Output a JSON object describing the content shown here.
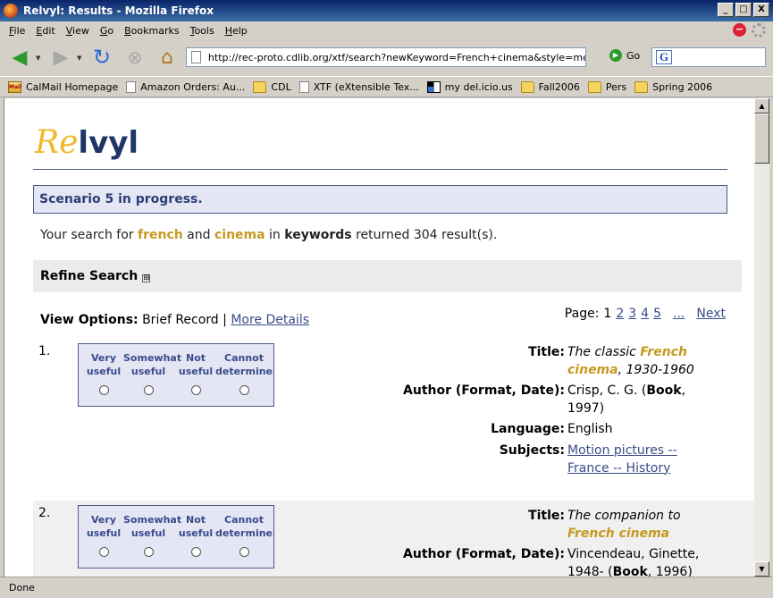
{
  "window": {
    "title": "Relvyl: Results - Mozilla Firefox",
    "buttons": [
      "_",
      "□",
      "X"
    ]
  },
  "menu": [
    {
      "key": "F",
      "rest": "ile"
    },
    {
      "key": "E",
      "rest": "dit"
    },
    {
      "key": "V",
      "rest": "iew"
    },
    {
      "key": "G",
      "rest": "o"
    },
    {
      "key": "B",
      "rest": "ookmarks"
    },
    {
      "key": "T",
      "rest": "ools"
    },
    {
      "key": "H",
      "rest": "elp"
    }
  ],
  "toolbar": {
    "url": "http://rec-proto.cdlib.org/xtf/search?newKeyword=French+cinema&style=melrec&bra",
    "go_label": "Go",
    "search_engine_letter": "G"
  },
  "bookmarks": [
    {
      "label": "CalMail Homepage",
      "icon": "mail"
    },
    {
      "label": "Amazon Orders: Au...",
      "icon": "page"
    },
    {
      "label": "CDL",
      "icon": "folder"
    },
    {
      "label": "XTF (eXtensible Tex...",
      "icon": "page"
    },
    {
      "label": "my del.icio.us",
      "icon": "delicious"
    },
    {
      "label": "Fall2006",
      "icon": "folder"
    },
    {
      "label": "Pers",
      "icon": "folder"
    },
    {
      "label": "Spring 2006",
      "icon": "folder"
    }
  ],
  "page": {
    "logo_re": "Re",
    "logo_lvyl": "lvyl",
    "scenario": "Scenario 5 in progress.",
    "result": {
      "prefix": "Your search for ",
      "kw1": "french",
      "and": " and ",
      "kw2": "cinema",
      "in": " in ",
      "field": "keywords",
      "suffix": " returned 304 result(s)."
    },
    "refine_label": "Refine Search",
    "refine_icon": "⊞",
    "view_options_label": "View Options:",
    "view_current": "Brief Record",
    "view_sep": "|",
    "view_more": "More Details",
    "pager": {
      "label": "Page:",
      "current": "1",
      "pages": [
        "2",
        "3",
        "4",
        "5"
      ],
      "ellipsis": "...",
      "next": "Next"
    },
    "rating_options": [
      [
        "Very",
        "useful"
      ],
      [
        "Somewhat",
        "useful"
      ],
      [
        "Not",
        "useful"
      ],
      [
        "Cannot",
        "determine"
      ]
    ],
    "labels": {
      "title": "Title:",
      "author": "Author (Format, Date):",
      "language": "Language:",
      "subjects": "Subjects:"
    },
    "records": [
      {
        "num": "1.",
        "title_pre": "The classic ",
        "title_kw1": "French",
        "title_kw2": "cinema",
        "title_post": ", 1930-1960",
        "author": "Crisp, C. G. (",
        "format": "Book",
        "date": ", 1997)",
        "language": "English",
        "subjects": "Motion pictures -- France -- History"
      },
      {
        "num": "2.",
        "title_pre": "The companion to",
        "title_kw": "French cinema",
        "author": "Vincendeau, Ginette, 1948- (",
        "format": "Book",
        "date": ", 1996)"
      }
    ]
  },
  "status": "Done"
}
